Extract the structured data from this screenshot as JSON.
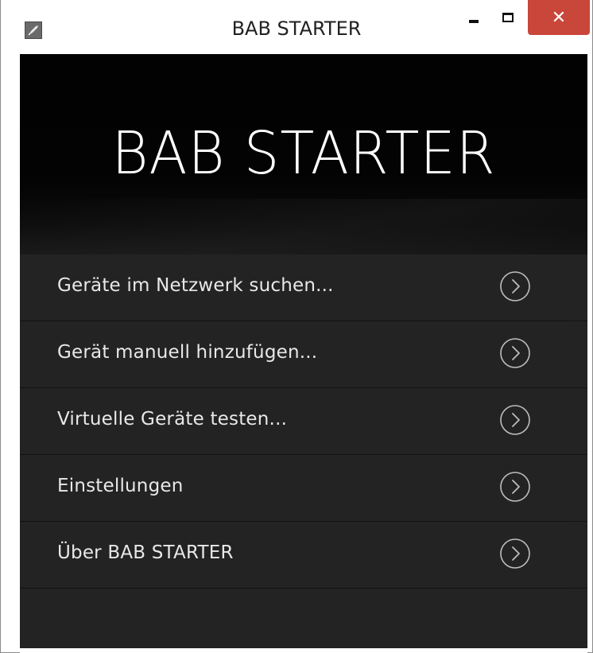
{
  "window": {
    "title": "BAB STARTER",
    "close_symbol": "✕",
    "icons": {
      "app": "app-rocket-icon",
      "minimize": "minimize-icon",
      "maximize": "maximize-icon",
      "close": "close-icon"
    },
    "colors": {
      "close_button": "#c9463b",
      "titlebar": "#ffffff"
    }
  },
  "hero": {
    "title": "BAB STARTER",
    "colors": {
      "background": "#030303",
      "text": "#ffffff"
    }
  },
  "menu": {
    "items": [
      {
        "label": "Geräte im Netzwerk suchen...",
        "icon": "chevron-right-circle-icon"
      },
      {
        "label": "Gerät manuell hinzufügen...",
        "icon": "chevron-right-circle-icon"
      },
      {
        "label": "Virtuelle Geräte testen...",
        "icon": "chevron-right-circle-icon"
      },
      {
        "label": "Einstellungen",
        "icon": "chevron-right-circle-icon"
      },
      {
        "label": "Über BAB STARTER",
        "icon": "chevron-right-circle-icon"
      }
    ],
    "colors": {
      "background": "#232323",
      "text": "#e8e8e8",
      "divider": "#111111"
    }
  }
}
